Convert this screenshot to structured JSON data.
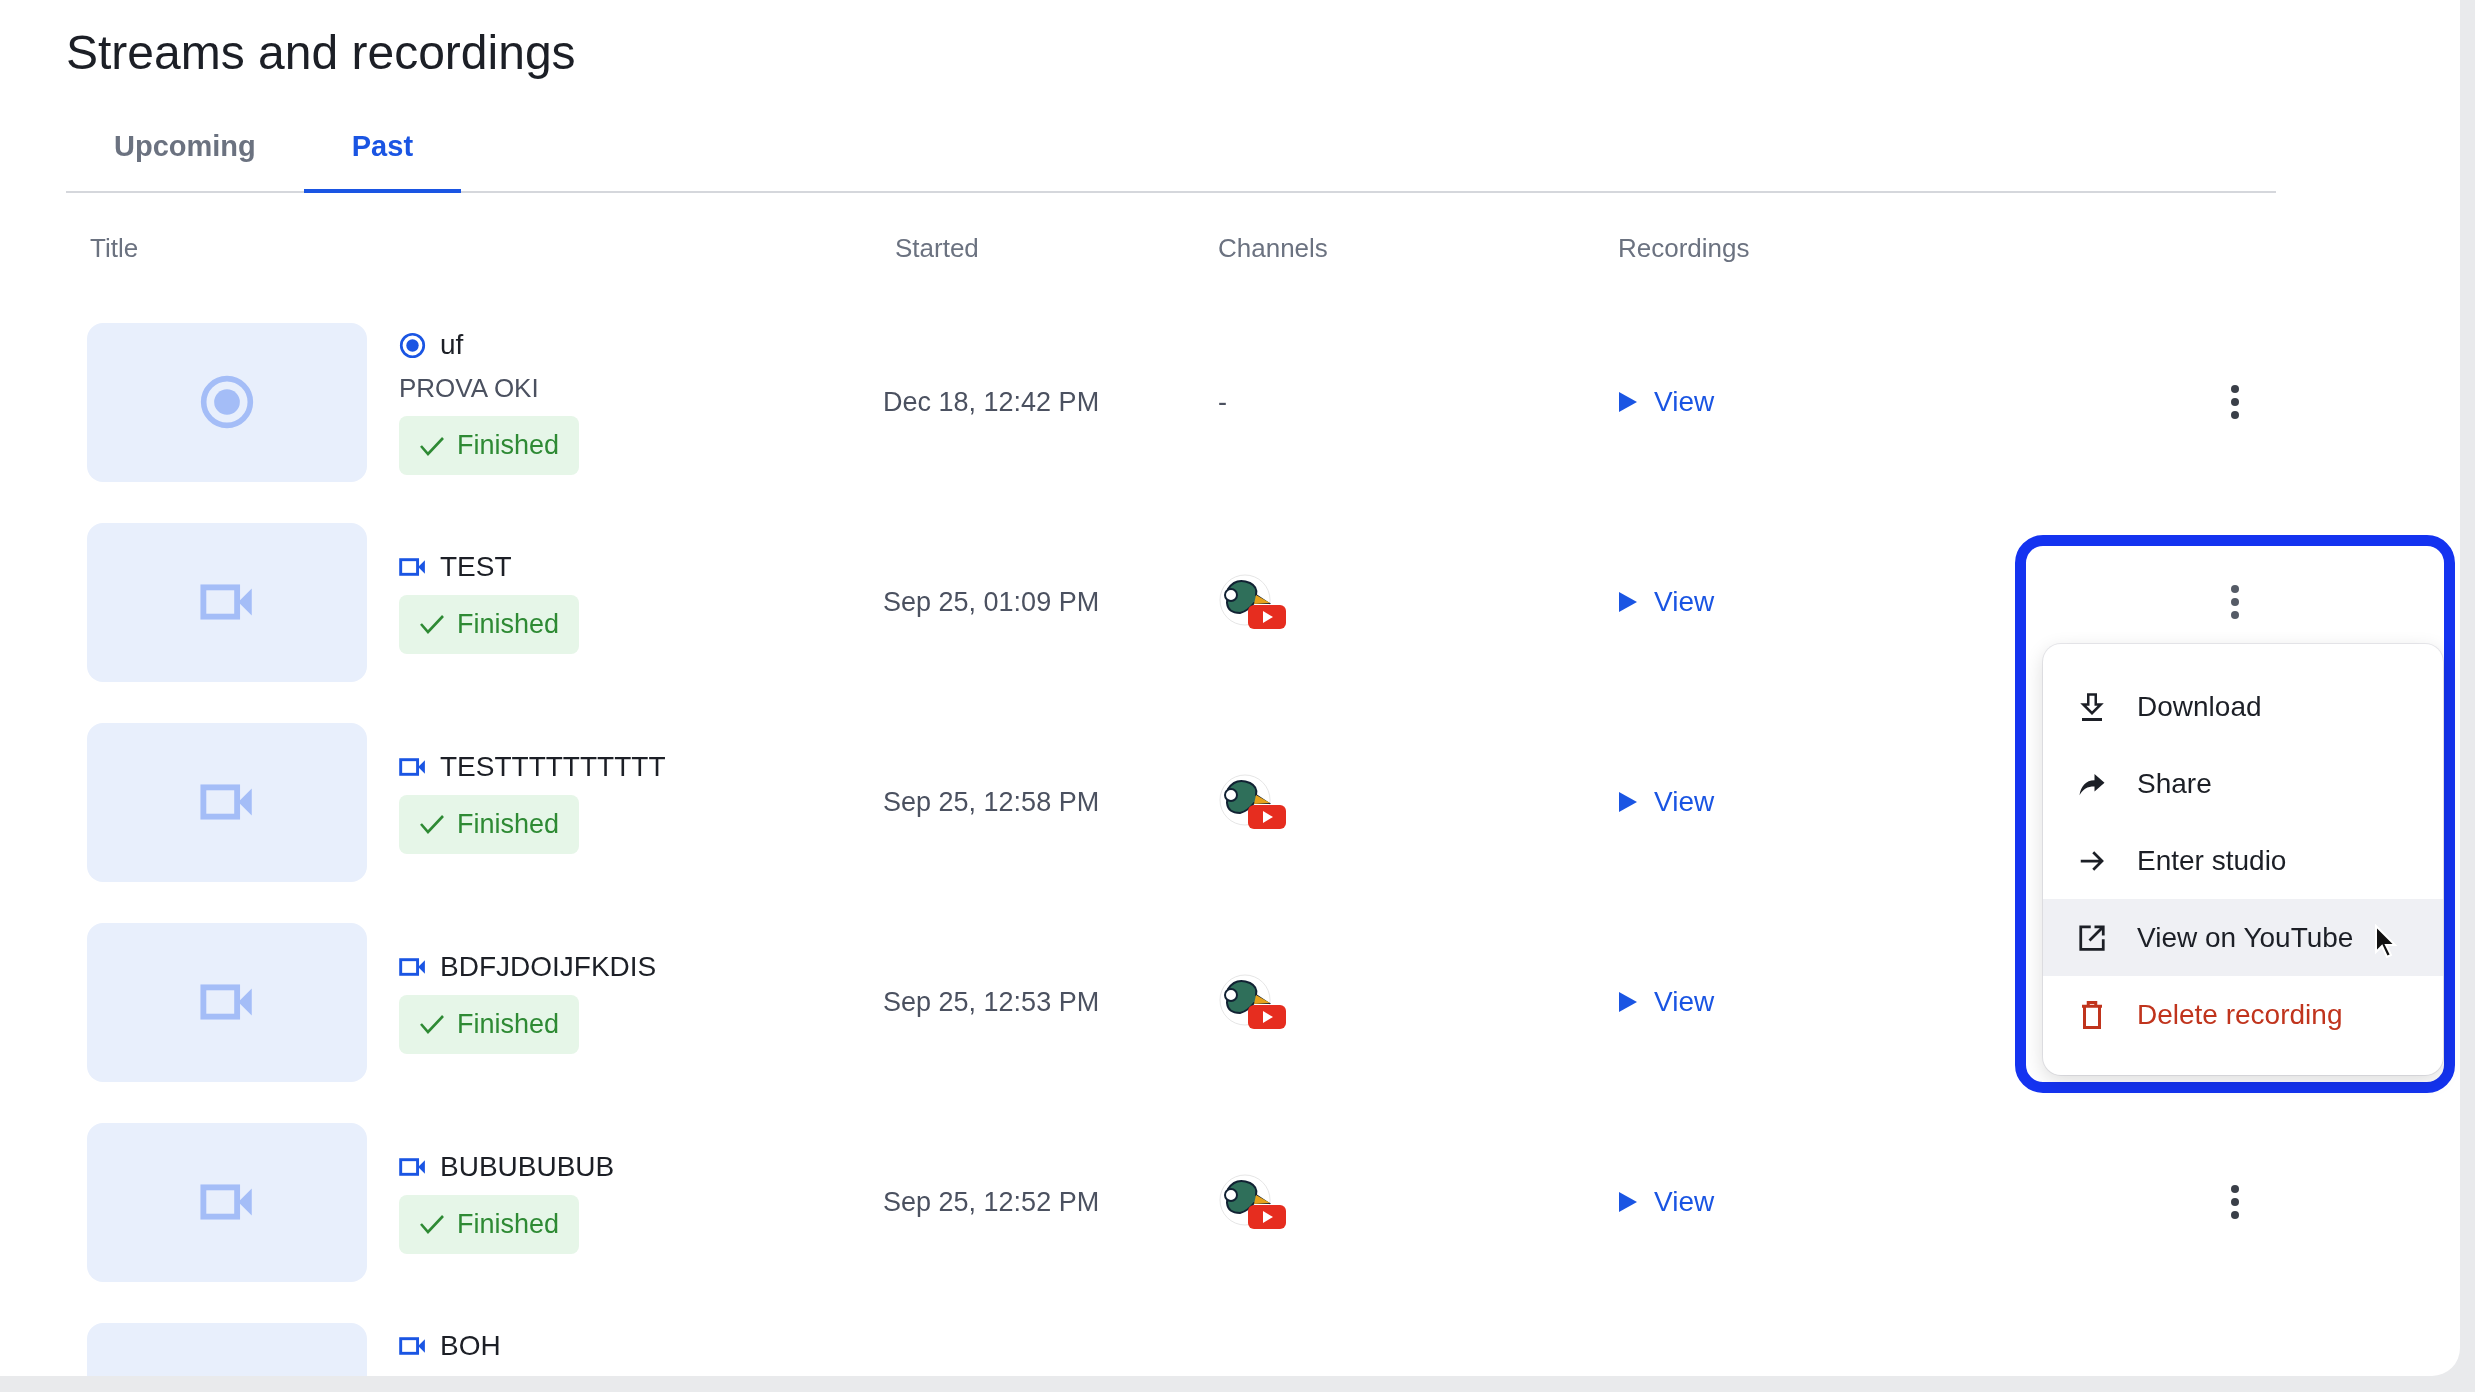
{
  "page_title": "Streams and recordings",
  "tabs": [
    {
      "label": "Upcoming",
      "selected": false
    },
    {
      "label": "Past",
      "selected": true
    }
  ],
  "columns": [
    "Title",
    "Started",
    "Channels",
    "Recordings"
  ],
  "rows": [
    {
      "kind": "live",
      "title": "uf",
      "subtitle": "PROVA OKI",
      "status": "Finished",
      "started": "Dec 18, 12:42 PM",
      "channel": {
        "kind": "text",
        "text": "-"
      },
      "recording_link": "View",
      "menu_open": false
    },
    {
      "kind": "video",
      "title": "TEST",
      "status": "Finished",
      "started": "Sep 25, 01:09 PM",
      "channel": {
        "kind": "avatar"
      },
      "recording_link": "View",
      "menu_open": true
    },
    {
      "kind": "video",
      "title": "TESTTTTTTTTTT",
      "status": "Finished",
      "started": "Sep 25, 12:58 PM",
      "channel": {
        "kind": "avatar"
      },
      "recording_link": "View"
    },
    {
      "kind": "video",
      "title": "BDFJDOIJFKDIS",
      "status": "Finished",
      "started": "Sep 25, 12:53 PM",
      "channel": {
        "kind": "avatar"
      },
      "recording_link": "View"
    },
    {
      "kind": "video",
      "title": "BUBUBUBUB",
      "status": "Finished",
      "started": "Sep 25, 12:52 PM",
      "channel": {
        "kind": "avatar"
      },
      "recording_link": "View",
      "menu_open": false
    },
    {
      "kind": "video",
      "title": "BOH"
    }
  ],
  "menu": {
    "items": [
      {
        "kind": "download",
        "label": "Download",
        "hovered": false
      },
      {
        "kind": "share",
        "label": "Share",
        "hovered": false
      },
      {
        "kind": "enter",
        "label": "Enter studio",
        "hovered": false
      },
      {
        "kind": "external",
        "label": "View on YouTube",
        "hovered": true
      },
      {
        "kind": "delete",
        "label": "Delete recording",
        "hovered": false
      }
    ]
  }
}
